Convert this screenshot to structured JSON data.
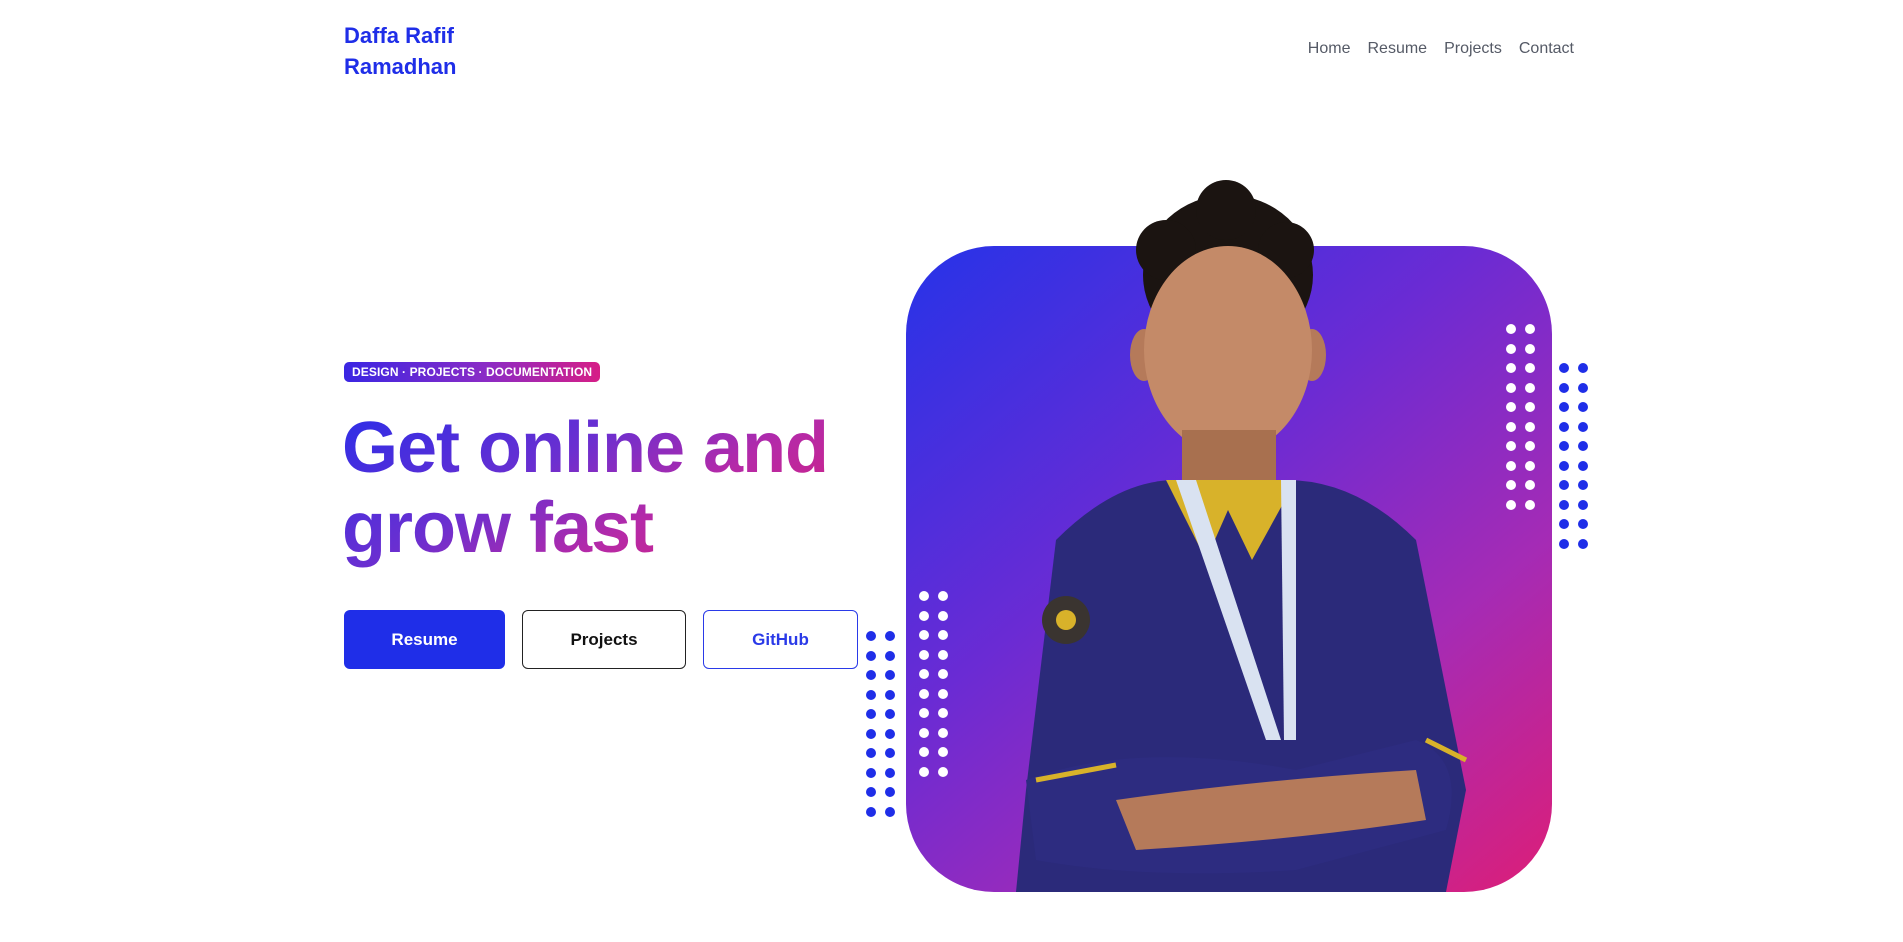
{
  "header": {
    "brand_line1": "Daffa Rafif",
    "brand_line2": "Ramadhan",
    "nav": [
      "Home",
      "Resume",
      "Projects",
      "Contact"
    ]
  },
  "hero": {
    "tag": "DESIGN · PROJECTS · DOCUMENTATION",
    "headline_line1": "Get online and",
    "headline_line2": "grow fast",
    "buttons": {
      "resume": "Resume",
      "projects": "Projects",
      "github": "GitHub"
    }
  },
  "colors": {
    "brand": "#1f2ee8",
    "gradient_start": "#2633e8",
    "gradient_end": "#dd1e77",
    "nav_text": "#555a66"
  },
  "icons": {
    "portrait": "person-portrait",
    "decor": "dot-grid"
  }
}
